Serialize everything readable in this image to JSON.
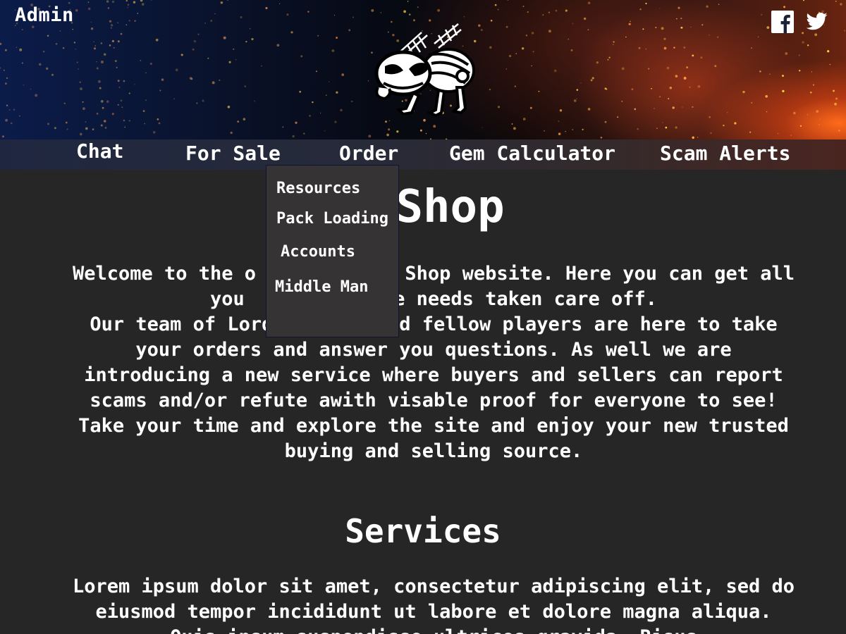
{
  "header": {
    "admin_label": "Admin",
    "logo_icon": "bug-mascot-logo",
    "social": [
      "facebook-icon",
      "twitter-icon"
    ]
  },
  "nav": {
    "items": [
      {
        "label": "Chat"
      },
      {
        "label": "For Sale"
      },
      {
        "label": "Order"
      },
      {
        "label": "Gem Calculator"
      },
      {
        "label": "Scam Alerts"
      }
    ]
  },
  "dropdown": {
    "parent": "Order",
    "items": [
      {
        "label": "Resources"
      },
      {
        "label": "Pack Loading"
      },
      {
        "label": "Accounts"
      },
      {
        "label": "Middle Man"
      }
    ]
  },
  "main": {
    "title_visible": "s Shop",
    "intro_paragraphs": [
      "Welcome to the o          os Shop website. Here you can get all you           ile needs taken care off.",
      "Our team of Lord          nd fellow players are here to take your orders and answer you questions. As well we are introducing a new service where buyers and sellers can report scams and/or refute awith visable proof for everyone to see! Take your time and explore the site and enjoy your new trusted buying and selling source."
    ],
    "services_title": "Services",
    "services_text": "Lorem ipsum dolor sit amet, consectetur adipiscing elit, sed do eiusmod tempor incididunt ut labore et dolore magna aliqua. Quis ipsum suspendisse ultrices gravida. Risus"
  },
  "colors": {
    "page_bg": "#262626",
    "dropdown_bg": "#353334",
    "text": "#ffffff"
  }
}
